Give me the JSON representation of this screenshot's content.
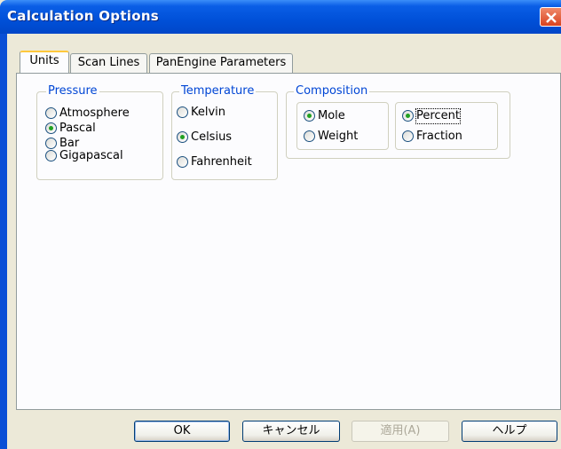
{
  "window": {
    "title": "Calculation Options"
  },
  "tabs": [
    {
      "label": "Units",
      "active": true
    },
    {
      "label": "Scan Lines",
      "active": false
    },
    {
      "label": "PanEngine Parameters",
      "active": false
    }
  ],
  "pressure": {
    "legend": "Pressure",
    "options": [
      "Atmosphere",
      "Pascal",
      "Bar",
      "Gigapascal"
    ],
    "selected": "Pascal"
  },
  "temperature": {
    "legend": "Temperature",
    "options": [
      "Kelvin",
      "Celsius",
      "Fahrenheit"
    ],
    "selected": "Celsius"
  },
  "composition": {
    "legend": "Composition",
    "basis": {
      "options": [
        "Mole",
        "Weight"
      ],
      "selected": "Mole"
    },
    "form": {
      "options": [
        "Percent",
        "Fraction"
      ],
      "selected": "Percent"
    }
  },
  "buttons": {
    "ok": "OK",
    "cancel": "キャンセル",
    "apply": "適用(A)",
    "help": "ヘルプ"
  },
  "colors": {
    "titlebar": "#0050d8",
    "legend_text": "#0046d5",
    "tab_highlight": "#ffc83c"
  },
  "icons": {
    "close": "close-icon"
  }
}
